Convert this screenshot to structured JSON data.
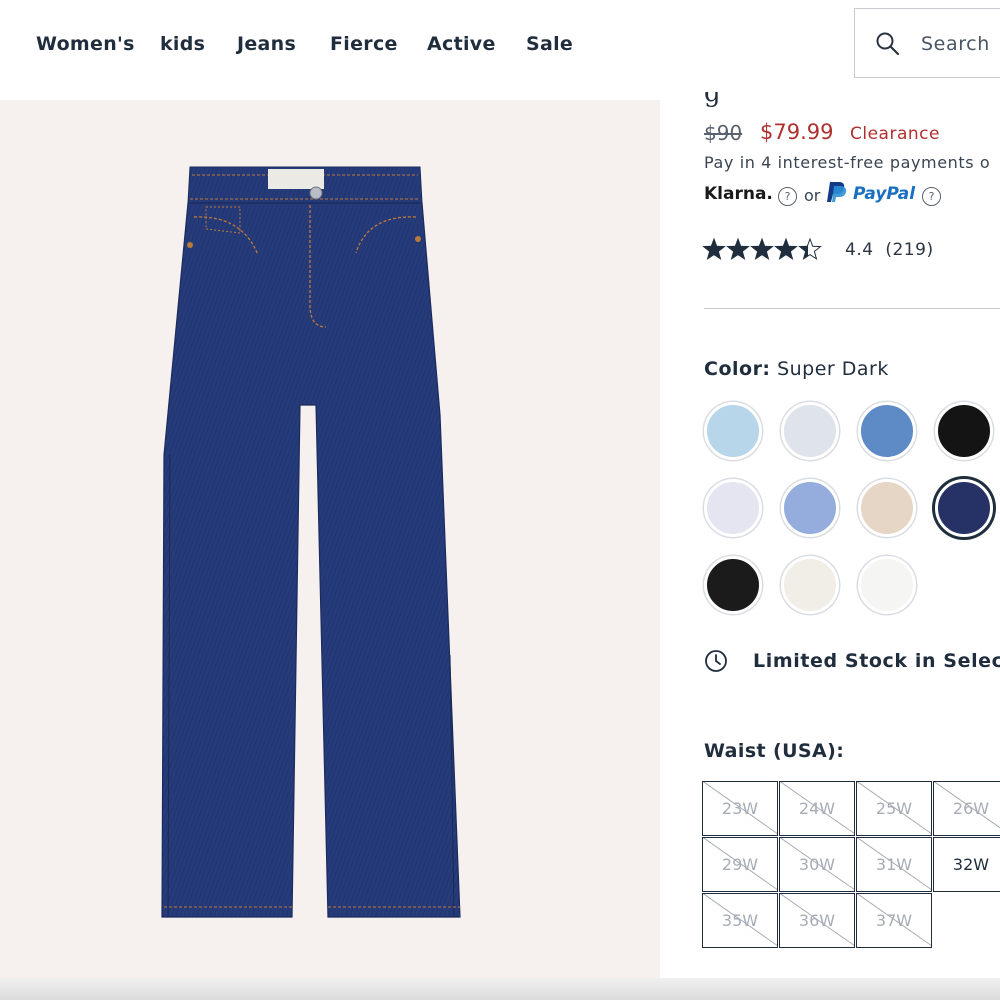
{
  "nav": {
    "items": [
      "Women's",
      "kids",
      "Jeans",
      "Fierce",
      "Active",
      "Sale"
    ],
    "search_label": "Search"
  },
  "product": {
    "title_fragment": "g",
    "original_price": "$90",
    "sale_price": "$79.99",
    "sale_tag": "Clearance",
    "payment_text": "Pay in 4 interest-free payments o",
    "klarna_label": "Klarna.",
    "or_text": "or",
    "paypal_label": "PayPal",
    "rating_value": "4.4",
    "rating_count": "(219)",
    "stars_filled": 4.4,
    "color_label": "Color:",
    "color_value": "Super Dark",
    "stock_text": "Limited Stock in Select",
    "waist_label": "Waist (USA):"
  },
  "swatches": [
    {
      "name": "light-blue",
      "color": "#b7d6ea"
    },
    {
      "name": "pale-gray-blue",
      "color": "#dfe3ea"
    },
    {
      "name": "medium-blue",
      "color": "#5e8bc6"
    },
    {
      "name": "black",
      "color": "#141414"
    },
    {
      "name": "lavender-white",
      "color": "#e4e5f1"
    },
    {
      "name": "light-wash-blue",
      "color": "#94addc"
    },
    {
      "name": "beige",
      "color": "#e6d6c6"
    },
    {
      "name": "super-dark",
      "color": "#263266",
      "selected": true
    },
    {
      "name": "washed-black",
      "color": "#1b1b1b"
    },
    {
      "name": "ecru",
      "color": "#f1eee8"
    },
    {
      "name": "white",
      "color": "#f5f5f4"
    }
  ],
  "sizes": [
    {
      "label": "23W",
      "available": false
    },
    {
      "label": "24W",
      "available": false
    },
    {
      "label": "25W",
      "available": false
    },
    {
      "label": "26W",
      "available": false
    },
    {
      "label": "29W",
      "available": false
    },
    {
      "label": "30W",
      "available": false
    },
    {
      "label": "31W",
      "available": false
    },
    {
      "label": "32W",
      "available": true
    },
    {
      "label": "35W",
      "available": false
    },
    {
      "label": "36W",
      "available": false
    },
    {
      "label": "37W",
      "available": false
    }
  ],
  "colors": {
    "text": "#1f2d3d",
    "sale": "#b0302e",
    "paypal": "#1a6fbf",
    "image_bg": "#f6f1ee",
    "denim": "#253a78"
  }
}
